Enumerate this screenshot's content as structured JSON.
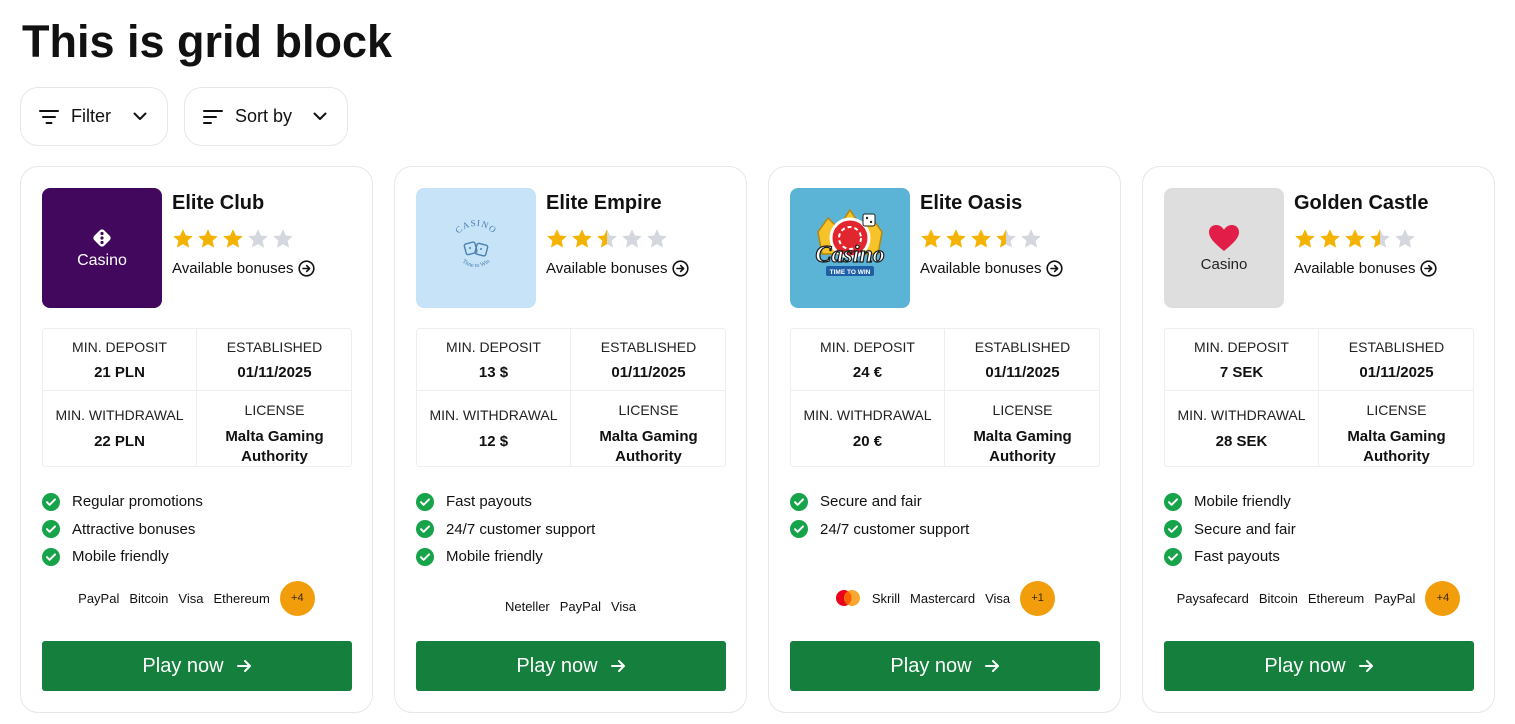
{
  "page_title": "This is grid block",
  "controls": {
    "filter_label": "Filter",
    "sort_label": "Sort by"
  },
  "colors": {
    "play_button": "#15803d",
    "star_filled": "#f5b301",
    "star_empty": "#d4d8de",
    "check": "#16a34a",
    "chip": "#f29d0c"
  },
  "cards": [
    {
      "name": "Elite Club",
      "rating": 3,
      "logo": {
        "style": "purple-dice",
        "text": "Casino"
      },
      "bonus_label": "Available bonuses",
      "stats": {
        "min_deposit_label": "MIN. DEPOSIT",
        "min_deposit": "21 PLN",
        "established_label": "ESTABLISHED",
        "established": "01/11/2025",
        "min_withdrawal_label": "MIN. WITHDRAWAL",
        "min_withdrawal": "22 PLN",
        "license_label": "LICENSE",
        "license": "Malta Gaming Authority"
      },
      "features": [
        "Regular promotions",
        "Attractive bonuses",
        "Mobile friendly"
      ],
      "payments": [
        "PayPal",
        "Bitcoin",
        "Visa",
        "Ethereum"
      ],
      "more_payments": "+4",
      "cta": "Play now"
    },
    {
      "name": "Elite Empire",
      "rating": 2.5,
      "logo": {
        "style": "blue-dice-stamp",
        "text": "CASINO",
        "subtext": "Time to Win"
      },
      "bonus_label": "Available bonuses",
      "stats": {
        "min_deposit_label": "MIN. DEPOSIT",
        "min_deposit": "13 $",
        "established_label": "ESTABLISHED",
        "established": "01/11/2025",
        "min_withdrawal_label": "MIN. WITHDRAWAL",
        "min_withdrawal": "12 $",
        "license_label": "LICENSE",
        "license": "Malta Gaming Authority"
      },
      "features": [
        "Fast payouts",
        "24/7 customer support",
        "Mobile friendly"
      ],
      "payments": [
        "Neteller",
        "PayPal",
        "Visa"
      ],
      "more_payments": "",
      "cta": "Play now"
    },
    {
      "name": "Elite Oasis",
      "rating": 3.5,
      "logo": {
        "style": "crown-chip",
        "text": "Casino",
        "subtext": "TIME TO WIN"
      },
      "bonus_label": "Available bonuses",
      "stats": {
        "min_deposit_label": "MIN. DEPOSIT",
        "min_deposit": "24 €",
        "established_label": "ESTABLISHED",
        "established": "01/11/2025",
        "min_withdrawal_label": "MIN. WITHDRAWAL",
        "min_withdrawal": "20 €",
        "license_label": "LICENSE",
        "license": "Malta Gaming Authority"
      },
      "features": [
        "Secure and fair",
        "24/7 customer support"
      ],
      "payments": [
        "Skrill",
        "Mastercard",
        "Visa"
      ],
      "payment_icon": "mastercard-logo-icon",
      "more_payments": "+1",
      "cta": "Play now"
    },
    {
      "name": "Golden Castle",
      "rating": 3.5,
      "logo": {
        "style": "grey-heart",
        "text": "Casino"
      },
      "bonus_label": "Available bonuses",
      "stats": {
        "min_deposit_label": "MIN. DEPOSIT",
        "min_deposit": "7 SEK",
        "established_label": "ESTABLISHED",
        "established": "01/11/2025",
        "min_withdrawal_label": "MIN. WITHDRAWAL",
        "min_withdrawal": "28 SEK",
        "license_label": "LICENSE",
        "license": "Malta Gaming Authority"
      },
      "features": [
        "Mobile friendly",
        "Secure and fair",
        "Fast payouts"
      ],
      "payments": [
        "Paysafecard",
        "Bitcoin",
        "Ethereum",
        "PayPal"
      ],
      "more_payments": "+4",
      "cta": "Play now"
    }
  ]
}
